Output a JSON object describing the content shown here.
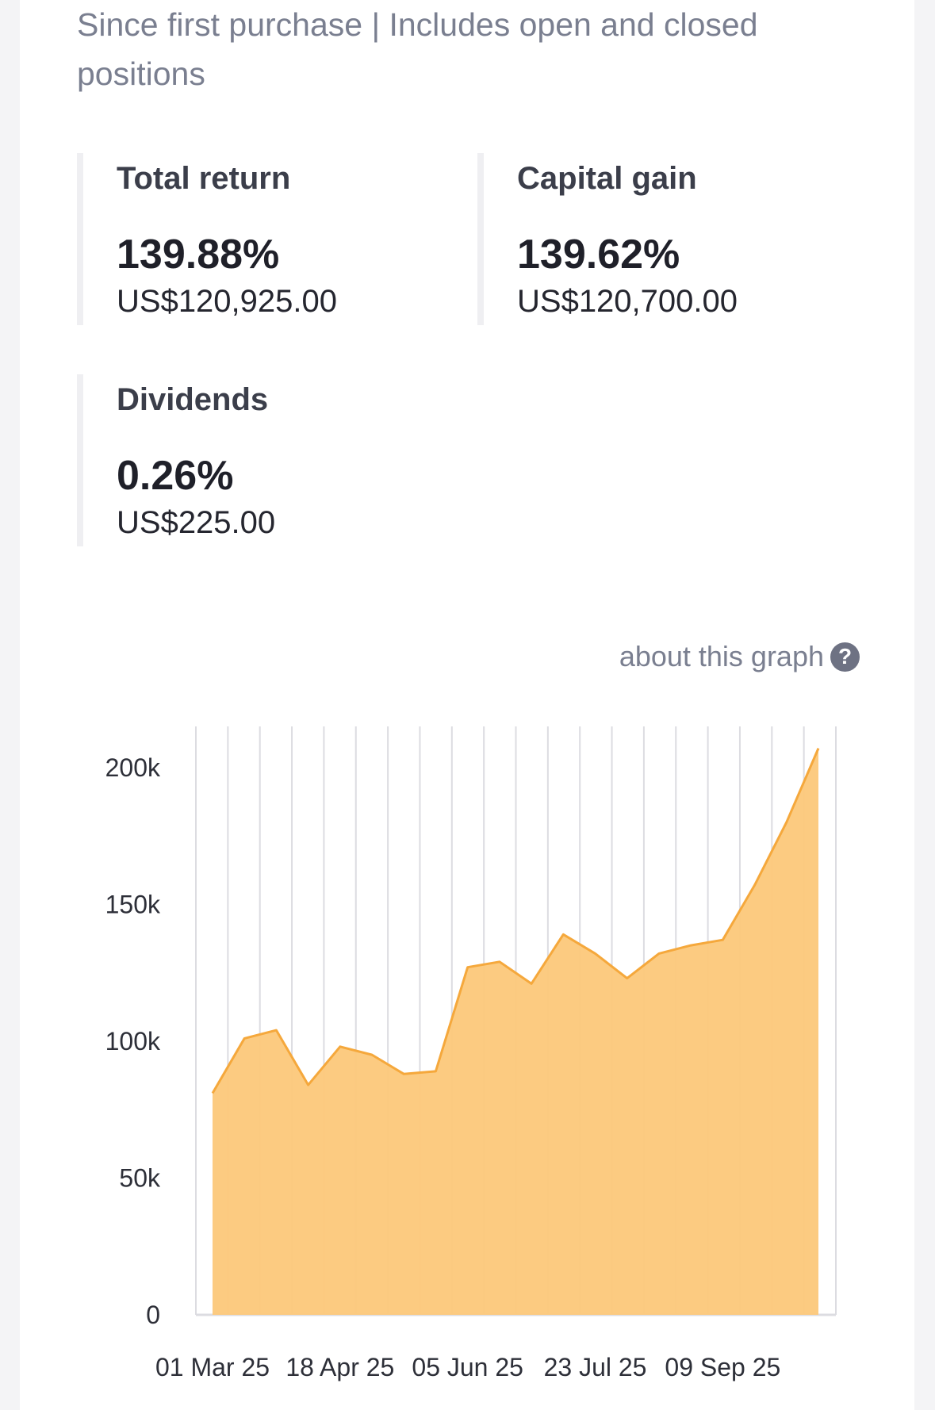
{
  "header": {
    "subtitle": "Since first purchase | Includes open and closed positions"
  },
  "metrics": {
    "total_return": {
      "label": "Total return",
      "percent": "139.88%",
      "amount": "US$120,925.00"
    },
    "capital_gain": {
      "label": "Capital gain",
      "percent": "139.62%",
      "amount": "US$120,700.00"
    },
    "dividends": {
      "label": "Dividends",
      "percent": "0.26%",
      "amount": "US$225.00"
    }
  },
  "graph": {
    "about_label": "about this graph",
    "help_icon": "?"
  },
  "colors": {
    "area_fill": "#fcc87a",
    "line": "#f5a83c",
    "grid": "#dcdce1"
  },
  "chart_data": {
    "type": "area",
    "x": [
      "01 Mar 25",
      "",
      "",
      "",
      "",
      "",
      "",
      "",
      "",
      "",
      "",
      "",
      "",
      "",
      "",
      "",
      "",
      "",
      "",
      ""
    ],
    "values": [
      81000,
      101000,
      104000,
      84000,
      98000,
      95000,
      88000,
      89000,
      127000,
      129000,
      121000,
      139000,
      132000,
      123000,
      132000,
      135000,
      137000,
      157000,
      180000,
      207000
    ],
    "xtick_labels": [
      "01 Mar 25",
      "18 Apr 25",
      "05 Jun 25",
      "23 Jul 25",
      "09 Sep 25"
    ],
    "xtick_index": [
      0,
      4,
      8,
      12,
      16
    ],
    "ytick_values": [
      0,
      50000,
      100000,
      150000,
      200000
    ],
    "ytick_labels": [
      "0",
      "50k",
      "100k",
      "150k",
      "200k"
    ],
    "ylim": [
      0,
      215000
    ],
    "grid": "vertical",
    "legend": "none"
  }
}
